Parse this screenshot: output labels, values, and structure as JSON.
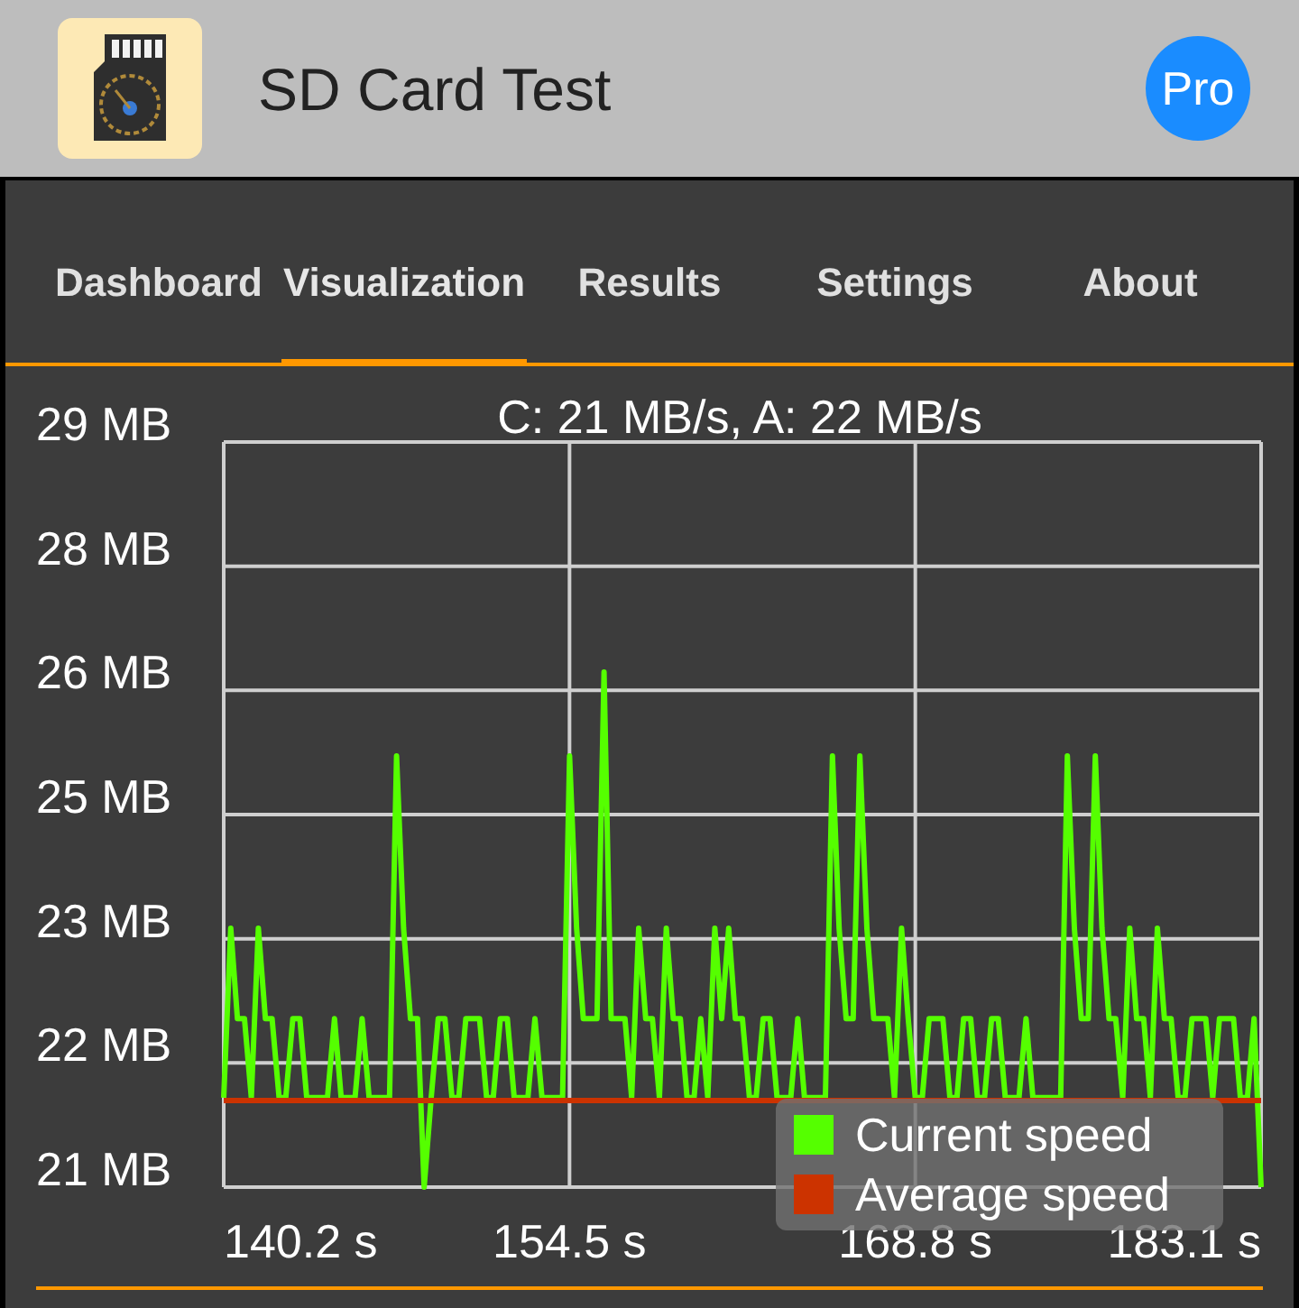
{
  "app_bar": {
    "title": "SD Card Test",
    "pro_button": "Pro"
  },
  "tabs": [
    {
      "label": "Dashboard",
      "selected": false
    },
    {
      "label": "Visualization",
      "selected": true
    },
    {
      "label": "Results",
      "selected": false
    },
    {
      "label": "Settings",
      "selected": false
    },
    {
      "label": "About",
      "selected": false
    }
  ],
  "chart": {
    "chart_data": {
      "type": "line",
      "title": "C: 21 MB/s, A: 22 MB/s",
      "x": [
        140.2,
        140.49,
        140.77,
        141.06,
        141.34,
        141.63,
        141.92,
        142.2,
        142.49,
        142.77,
        143.06,
        143.35,
        143.63,
        143.92,
        144.2,
        144.49,
        144.78,
        145.06,
        145.35,
        145.63,
        145.92,
        146.21,
        146.49,
        146.78,
        147.06,
        147.35,
        147.64,
        147.92,
        148.21,
        148.49,
        148.78,
        149.07,
        149.35,
        149.64,
        149.92,
        150.21,
        150.5,
        150.78,
        151.07,
        151.35,
        151.64,
        151.93,
        152.21,
        152.5,
        152.78,
        153.07,
        153.36,
        153.64,
        153.93,
        154.21,
        154.5,
        154.79,
        155.07,
        155.36,
        155.64,
        155.93,
        156.22,
        156.5,
        156.79,
        157.07,
        157.36,
        157.65,
        157.93,
        158.22,
        158.5,
        158.79,
        159.08,
        159.36,
        159.65,
        159.93,
        160.22,
        160.51,
        160.79,
        161.08,
        161.36,
        161.65,
        161.94,
        162.22,
        162.51,
        162.79,
        163.08,
        163.37,
        163.65,
        163.94,
        164.22,
        164.51,
        164.8,
        165.08,
        165.37,
        165.65,
        165.94,
        166.23,
        166.51,
        166.8,
        167.08,
        167.37,
        167.66,
        167.94,
        168.23,
        168.51,
        168.8,
        169.09,
        169.37,
        169.66,
        169.94,
        170.23,
        170.52,
        170.8,
        171.09,
        171.37,
        171.66,
        171.95,
        172.23,
        172.52,
        172.8,
        173.09,
        173.38,
        173.66,
        173.95,
        174.23,
        174.52,
        174.81,
        175.09,
        175.38,
        175.66,
        175.95,
        176.24,
        176.52,
        176.81,
        177.09,
        177.38,
        177.67,
        177.95,
        178.24,
        178.52,
        178.81,
        179.1,
        179.38,
        179.67,
        179.95,
        180.24,
        180.53,
        180.81,
        181.1,
        181.38,
        181.67,
        181.96,
        182.24,
        182.53,
        182.81,
        183.1
      ],
      "series": [
        {
          "name": "Current speed",
          "color": "#55ff00",
          "values": [
            21.96,
            23.78,
            22.81,
            22.81,
            21.96,
            23.78,
            22.81,
            22.81,
            21.96,
            21.96,
            22.81,
            22.81,
            21.96,
            21.96,
            21.96,
            21.96,
            22.81,
            21.96,
            21.96,
            21.96,
            22.81,
            21.96,
            21.96,
            21.96,
            21.96,
            25.63,
            23.78,
            22.81,
            22.81,
            21.0,
            21.96,
            22.81,
            22.81,
            21.96,
            21.96,
            22.81,
            22.81,
            22.81,
            21.96,
            21.96,
            22.81,
            22.81,
            21.96,
            21.96,
            21.96,
            22.81,
            21.96,
            21.96,
            21.96,
            21.96,
            25.63,
            23.78,
            22.81,
            22.81,
            22.81,
            26.53,
            22.81,
            22.81,
            22.81,
            21.96,
            23.78,
            22.81,
            22.81,
            21.96,
            23.78,
            22.81,
            22.81,
            21.96,
            21.96,
            22.81,
            21.96,
            23.78,
            22.81,
            23.78,
            22.81,
            22.81,
            21.96,
            21.96,
            22.81,
            22.81,
            21.96,
            21.96,
            21.96,
            22.81,
            21.96,
            21.96,
            21.96,
            21.96,
            25.63,
            23.78,
            22.81,
            22.81,
            25.63,
            23.78,
            22.81,
            22.81,
            22.81,
            21.96,
            23.78,
            22.81,
            21.96,
            21.96,
            22.81,
            22.81,
            22.81,
            21.96,
            21.96,
            22.81,
            22.81,
            21.96,
            21.96,
            22.81,
            22.81,
            21.96,
            21.96,
            21.96,
            22.81,
            21.96,
            21.96,
            21.96,
            21.96,
            21.96,
            25.63,
            23.78,
            22.81,
            22.81,
            25.63,
            23.78,
            22.81,
            22.81,
            21.96,
            23.78,
            22.81,
            22.81,
            21.96,
            23.78,
            22.81,
            22.81,
            21.96,
            21.96,
            22.81,
            22.81,
            22.81,
            21.96,
            22.81,
            22.81,
            22.81,
            21.96,
            21.96,
            22.81,
            21.0
          ]
        },
        {
          "name": "Average speed",
          "color": "#cc3300",
          "values": [
            21.93,
            21.93,
            21.93,
            21.93,
            21.93,
            21.93,
            21.93,
            21.93,
            21.93,
            21.93,
            21.93,
            21.93,
            21.93,
            21.93,
            21.93,
            21.93,
            21.93,
            21.93,
            21.93,
            21.93,
            21.93,
            21.93,
            21.93,
            21.93,
            21.93,
            21.93,
            21.93,
            21.93,
            21.93,
            21.93,
            21.93,
            21.93,
            21.93,
            21.93,
            21.93,
            21.93,
            21.93,
            21.93,
            21.93,
            21.93,
            21.93,
            21.93,
            21.93,
            21.93,
            21.93,
            21.93,
            21.93,
            21.93,
            21.93,
            21.93,
            21.93,
            21.93,
            21.93,
            21.93,
            21.93,
            21.93,
            21.93,
            21.93,
            21.93,
            21.93,
            21.93,
            21.93,
            21.93,
            21.93,
            21.93,
            21.93,
            21.93,
            21.93,
            21.93,
            21.93,
            21.93,
            21.93,
            21.93,
            21.93,
            21.93,
            21.93,
            21.93,
            21.93,
            21.93,
            21.93,
            21.93,
            21.93,
            21.93,
            21.93,
            21.93,
            21.93,
            21.93,
            21.93,
            21.93,
            21.93,
            21.93,
            21.93,
            21.93,
            21.93,
            21.93,
            21.93,
            21.93,
            21.93,
            21.93,
            21.93,
            21.93,
            21.93,
            21.93,
            21.93,
            21.93,
            21.93,
            21.93,
            21.93,
            21.93,
            21.93,
            21.93,
            21.93,
            21.93,
            21.93,
            21.93,
            21.93,
            21.93,
            21.93,
            21.93,
            21.93,
            21.93,
            21.93,
            21.93,
            21.93,
            21.93,
            21.93,
            21.93,
            21.93,
            21.93,
            21.93,
            21.93,
            21.93,
            21.93,
            21.93,
            21.93,
            21.93,
            21.93,
            21.93,
            21.93,
            21.93,
            21.93,
            21.93,
            21.93,
            21.93,
            21.93,
            21.93,
            21.93,
            21.93,
            21.93,
            21.93,
            21.93
          ]
        }
      ],
      "xlim": [
        140.2,
        183.1
      ],
      "ylim": [
        21,
        29
      ],
      "xticks": [
        {
          "value": 140.2,
          "label": "140.2 s"
        },
        {
          "value": 154.5,
          "label": "154.5 s"
        },
        {
          "value": 168.8,
          "label": "168.8 s"
        },
        {
          "value": 183.1,
          "label": "183.1 s"
        }
      ],
      "yticks": [
        {
          "value": 29,
          "label": "29 MB"
        },
        {
          "value": 25,
          "label": "25 MB"
        },
        {
          "value": 21,
          "label": "21 MB"
        }
      ],
      "grid": true,
      "legend": true
    },
    "y_axis_labels": [
      "28 MB",
      "26 MB",
      "23 MB",
      "22 MB"
    ]
  }
}
